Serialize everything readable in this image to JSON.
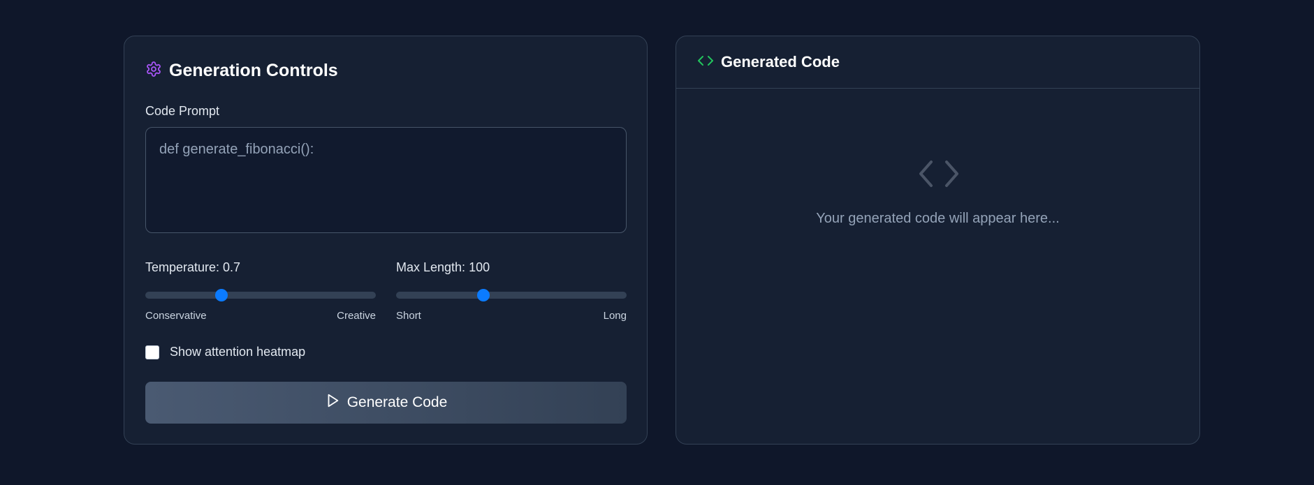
{
  "controls": {
    "title": "Generation Controls",
    "title_icon": "gear-icon",
    "prompt_label": "Code Prompt",
    "prompt_value": "def generate_fibonacci():",
    "temperature": {
      "label": "Temperature: 0.7",
      "value": 0.7,
      "fraction": 0.33,
      "min_label": "Conservative",
      "max_label": "Creative"
    },
    "max_length": {
      "label": "Max Length: 100",
      "value": 100,
      "fraction": 0.38,
      "min_label": "Short",
      "max_label": "Long"
    },
    "heatmap_checkbox": {
      "label": "Show attention heatmap",
      "checked": false
    },
    "generate_button": {
      "label": "Generate Code",
      "icon": "play-icon"
    }
  },
  "output": {
    "title": "Generated Code",
    "title_icon": "code-icon",
    "placeholder_icon": "code-icon",
    "placeholder_text": "Your generated code will appear here..."
  },
  "colors": {
    "background": "#0f172a",
    "panel": "#162033",
    "accent_purple": "#a855f7",
    "accent_green": "#22c55e",
    "slider_thumb": "#0b7bff"
  }
}
